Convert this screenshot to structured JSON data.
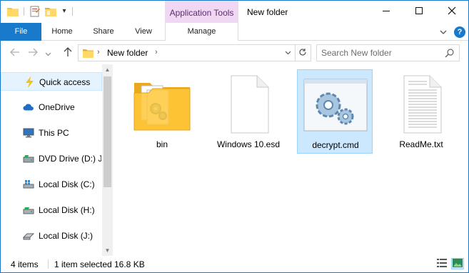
{
  "titlebar": {
    "contextual_tab_header": "Application Tools",
    "window_title": "New folder",
    "minimize_icon": "minimize-icon",
    "maximize_icon": "maximize-icon",
    "close_icon": "close-icon"
  },
  "ribbon": {
    "tabs": [
      {
        "label": "File"
      },
      {
        "label": "Home"
      },
      {
        "label": "Share"
      },
      {
        "label": "View"
      },
      {
        "label": "Manage"
      }
    ],
    "help_label": "?"
  },
  "address": {
    "breadcrumb": "New folder",
    "search_placeholder": "Search New folder"
  },
  "navpane": {
    "items": [
      {
        "label": "Quick access",
        "icon": "star-icon"
      },
      {
        "label": "OneDrive",
        "icon": "cloud-icon"
      },
      {
        "label": "This PC",
        "icon": "computer-icon"
      },
      {
        "label": "DVD Drive (D:) J_",
        "icon": "dvd-drive-icon"
      },
      {
        "label": "Local Disk (C:)",
        "icon": "windows-disk-icon"
      },
      {
        "label": "Local Disk (H:)",
        "icon": "disk-icon"
      },
      {
        "label": "Local Disk (J:)",
        "icon": "disk-icon"
      }
    ]
  },
  "files": [
    {
      "name": "bin",
      "type": "folder"
    },
    {
      "name": "Windows 10.esd",
      "type": "blank-file"
    },
    {
      "name": "decrypt.cmd",
      "type": "cmd-file"
    },
    {
      "name": "ReadMe.txt",
      "type": "text-file"
    }
  ],
  "status": {
    "item_count": "4 items",
    "selection": "1 item selected",
    "size": "16.8 KB"
  },
  "colors": {
    "accent": "#1979ca",
    "contextual_tab": "#f0d8f5",
    "selection": "#cce8ff",
    "folder": "#f8c33c"
  }
}
